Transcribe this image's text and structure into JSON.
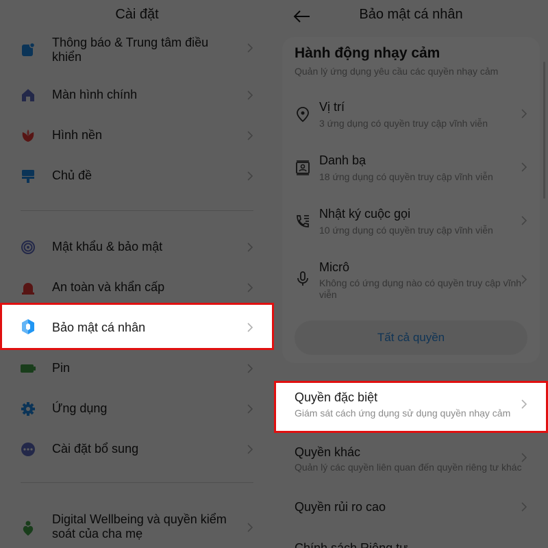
{
  "left": {
    "title": "Cài đặt",
    "items_group1": [
      {
        "label": "Thông báo & Trung tâm điều khiển",
        "icon": "notification-icon",
        "color": "#1e88e5"
      },
      {
        "label": "Màn hình chính",
        "icon": "home-icon",
        "color": "#5c6bc0"
      },
      {
        "label": "Hình nền",
        "icon": "wallpaper-flower-icon",
        "color": "#e53935"
      },
      {
        "label": "Chủ đề",
        "icon": "theme-brush-icon",
        "color": "#1e88e5"
      }
    ],
    "items_group2": [
      {
        "label": "Mật khẩu & bảo mật",
        "icon": "fingerprint-icon",
        "color": "#5c6bc0"
      },
      {
        "label": "An toàn và khẩn cấp",
        "icon": "emergency-alarm-icon",
        "color": "#e53935"
      },
      {
        "label": "Bảo mật cá nhân",
        "icon": "privacy-shield-icon",
        "color": "#2196f3"
      },
      {
        "label": "Pin",
        "icon": "battery-icon",
        "color": "#43a047"
      },
      {
        "label": "Ứng dụng",
        "icon": "gear-icon",
        "color": "#1e88e5"
      },
      {
        "label": "Cài đặt bổ sung",
        "icon": "more-dots-icon",
        "color": "#5c6bc0"
      }
    ],
    "items_group3": [
      {
        "label": "Digital Wellbeing và quyền kiểm soát của cha mẹ",
        "icon": "wellbeing-icon",
        "color": "#43a047"
      }
    ]
  },
  "right": {
    "title": "Bảo mật cá nhân",
    "section_title": "Hành động nhạy cảm",
    "section_subtitle": "Quản lý ứng dụng yêu cầu các quyền nhạy cảm",
    "permissions": [
      {
        "title": "Vị trí",
        "desc": "3 ứng dụng có quyền truy cập vĩnh viễn",
        "icon": "location-pin-icon"
      },
      {
        "title": "Danh bạ",
        "desc": "18 ứng dụng có quyền truy cập vĩnh viễn",
        "icon": "contacts-icon"
      },
      {
        "title": "Nhật ký cuộc gọi",
        "desc": "10 ứng dụng có quyền truy cập vĩnh viễn",
        "icon": "call-log-icon"
      },
      {
        "title": "Micrô",
        "desc": "Không có ứng dụng nào có quyền truy cập vĩnh viễn",
        "icon": "microphone-icon"
      }
    ],
    "all_permissions_button": "Tất cả quyền",
    "settings": [
      {
        "title": "Quyền đặc biệt",
        "desc": "Giám sát cách ứng dụng sử dụng quyền nhạy cảm"
      },
      {
        "title": "Quyền khác",
        "desc": "Quản lý các quyền liên quan đến quyền riêng tư khác"
      },
      {
        "title": "Quyền rủi ro cao",
        "desc": ""
      },
      {
        "title": "Chính sách Riêng tư",
        "desc": ""
      }
    ]
  },
  "colors": {
    "highlight": "#e01010",
    "accent_blue": "#2a8ae0"
  }
}
